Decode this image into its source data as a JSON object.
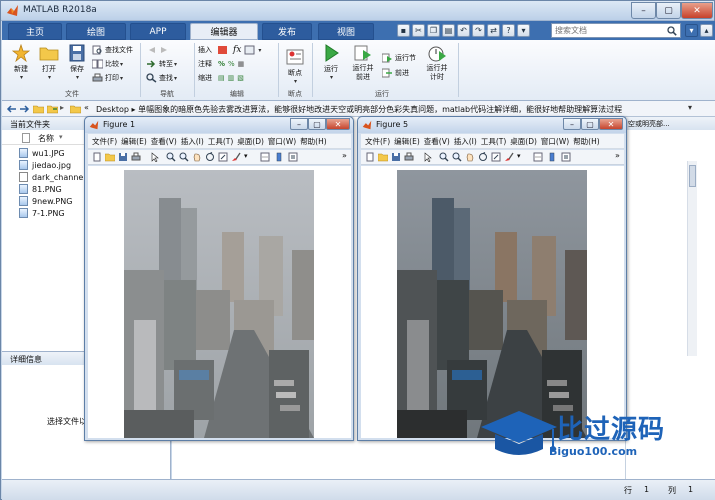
{
  "window": {
    "title": "MATLAB R2018a"
  },
  "tabs": [
    {
      "label": "主页",
      "active": false
    },
    {
      "label": "绘图",
      "active": false
    },
    {
      "label": "APP",
      "active": false
    },
    {
      "label": "编辑器",
      "active": true
    },
    {
      "label": "发布",
      "active": false
    },
    {
      "label": "视图",
      "active": false
    }
  ],
  "search": {
    "placeholder": "搜索文档"
  },
  "ribbon": {
    "file": {
      "group": "文件",
      "new": "新建",
      "open": "打开",
      "save": "保存",
      "find_files": "查找文件",
      "compare": "比较",
      "print": "打印"
    },
    "navigate": {
      "group": "导航",
      "goto": "转至",
      "find": "查找"
    },
    "edit": {
      "group": "编辑",
      "insert": "插入",
      "comment": "注释",
      "indent": "缩进"
    },
    "breakpoints": {
      "group": "断点",
      "breakpoints": "断点"
    },
    "run": {
      "group": "运行",
      "run": "运行",
      "run_advance": "运行并\n前进",
      "run_section": "运行节",
      "advance": "前进",
      "run_time": "运行并\n计时"
    }
  },
  "address": {
    "path": "Desktop ▸ 单幅图象的暗原色先验去雾改进算法，能够很好地改进天空或明亮部分色彩失真问题，matlab代码注解详细，能很好地帮助理解算法过程"
  },
  "current_folder": {
    "header": "当前文件夹",
    "column": "名称",
    "files": [
      "wu1.JPG",
      "jiedao.jpg",
      "dark_channel",
      "81.PNG",
      "9new.PNG",
      "7-1.PNG"
    ]
  },
  "details": {
    "header": "详细信息",
    "message": "选择文件以"
  },
  "workspace": {
    "header": "空或明亮部..."
  },
  "figures": [
    {
      "title": "Figure 1",
      "menu": [
        "文件(F)",
        "编辑(E)",
        "查看(V)",
        "插入(I)",
        "工具(T)",
        "桌面(D)",
        "窗口(W)",
        "帮助(H)"
      ]
    },
    {
      "title": "Figure 5",
      "menu": [
        "文件(F)",
        "编辑(E)",
        "查看(V)",
        "插入(I)",
        "工具(T)",
        "桌面(D)",
        "窗口(W)",
        "帮助(H)"
      ]
    }
  ],
  "status": {
    "row_label": "行",
    "row": "1",
    "col_label": "列",
    "col": "1"
  },
  "watermark": {
    "text": "比过源码",
    "url": "Biguo100.com"
  },
  "colors": {
    "tab_bar": "#3d6fb0",
    "accent": "#1565c0",
    "watermark_blue": "#1e63b8"
  }
}
